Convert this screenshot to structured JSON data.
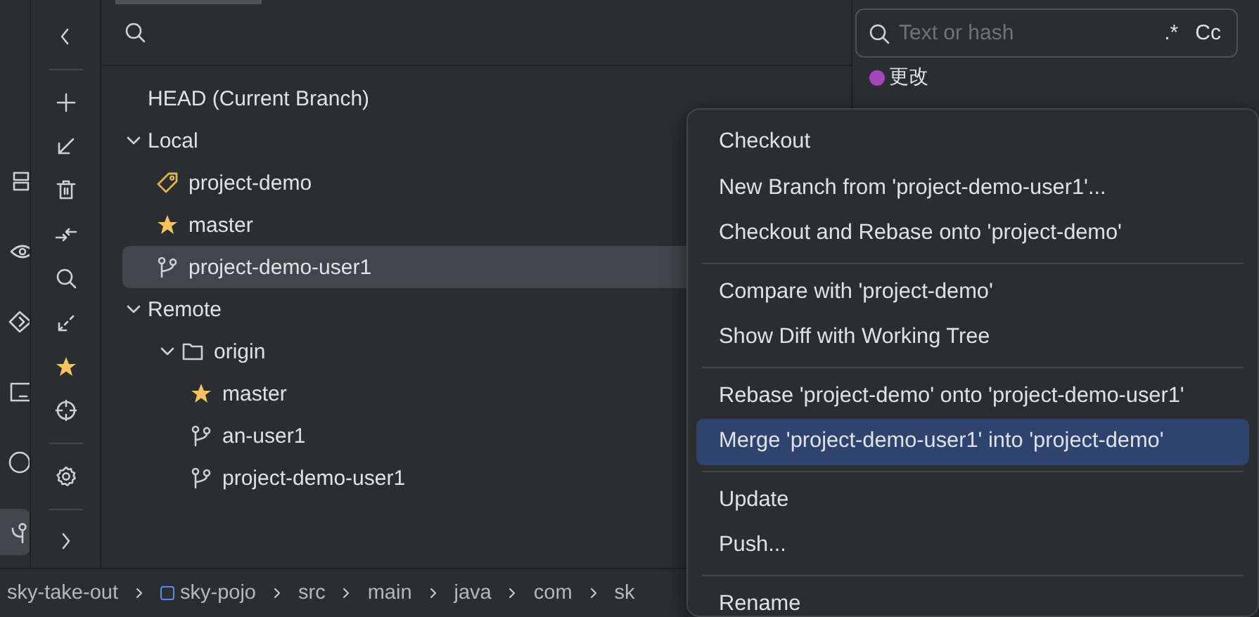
{
  "search_bar": {
    "kind": "search"
  },
  "tree": [
    {
      "label": "HEAD (Current Branch)",
      "selected": false
    },
    {
      "label": "Local",
      "expanded": true,
      "selected": false,
      "children": [
        {
          "label": "project-demo",
          "kind": "tag",
          "selected": false
        },
        {
          "label": "master",
          "kind": "favorite",
          "selected": false
        },
        {
          "label": "project-demo-user1",
          "kind": "branch",
          "selected": true
        }
      ]
    },
    {
      "label": "Remote",
      "expanded": true,
      "selected": false,
      "children": [
        {
          "label": "origin",
          "kind": "folder",
          "expanded": true,
          "selected": false,
          "children": [
            {
              "label": "master",
              "kind": "favorite",
              "selected": false
            },
            {
              "label": "an-user1",
              "kind": "branch",
              "selected": false
            },
            {
              "label": "project-demo-user1",
              "kind": "branch",
              "selected": false
            }
          ]
        }
      ]
    }
  ],
  "log_panel": {
    "search": {
      "placeholder": "Text or hash"
    },
    "regex_toggle": ".*",
    "case_toggle": "Cc",
    "commits": [
      {
        "message": "更改",
        "color": "#a347ba"
      }
    ]
  },
  "context_menu": [
    [
      {
        "label": "Checkout",
        "selected": false
      },
      {
        "label": "New Branch from 'project-demo-user1'...",
        "selected": false
      },
      {
        "label": "Checkout and Rebase onto 'project-demo'",
        "selected": false
      }
    ],
    [
      {
        "label": "Compare with 'project-demo'",
        "selected": false
      },
      {
        "label": "Show Diff with Working Tree",
        "selected": false
      }
    ],
    [
      {
        "label": "Rebase 'project-demo' onto 'project-demo-user1'",
        "selected": false
      },
      {
        "label": "Merge 'project-demo-user1' into 'project-demo'",
        "selected": true
      }
    ],
    [
      {
        "label": "Update",
        "selected": false
      },
      {
        "label": "Push...",
        "selected": false
      }
    ],
    [
      {
        "label": "Rename",
        "selected": false
      }
    ]
  ],
  "breadcrumbs": [
    {
      "label": "sky-take-out",
      "kind": "project"
    },
    {
      "label": "sky-pojo",
      "kind": "module"
    },
    {
      "label": "src",
      "kind": "folder"
    },
    {
      "label": "main",
      "kind": "folder"
    },
    {
      "label": "java",
      "kind": "folder"
    },
    {
      "label": "com",
      "kind": "folder"
    },
    {
      "label": "sk",
      "kind": "folder"
    }
  ]
}
